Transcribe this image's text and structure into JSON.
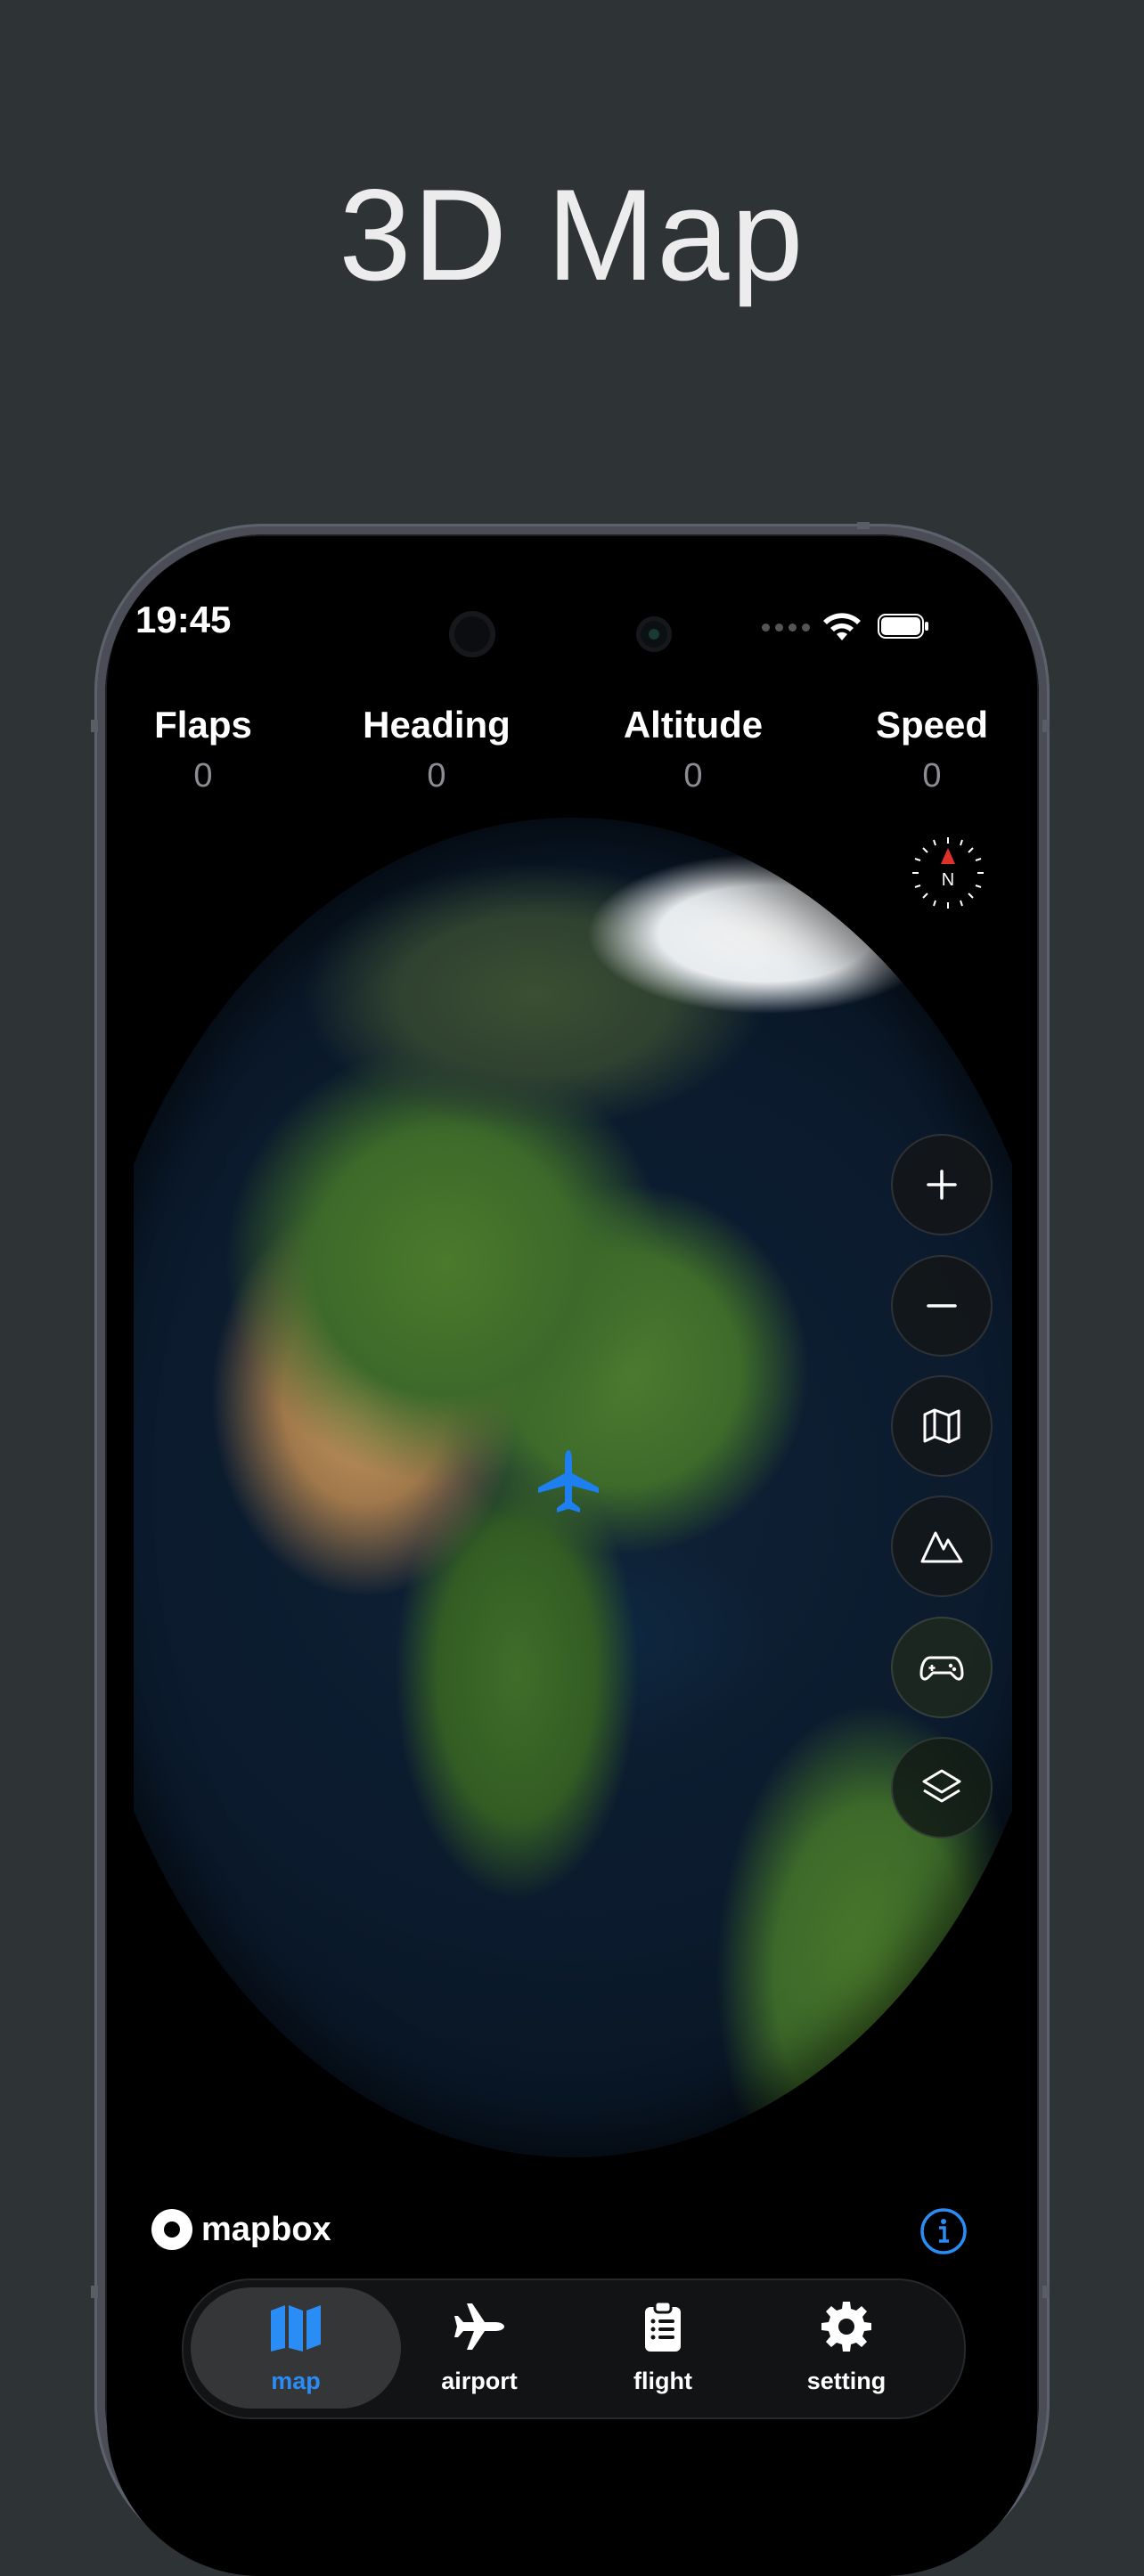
{
  "promo": {
    "title": "3D Map"
  },
  "status_bar": {
    "time": "19:45",
    "wifi_icon": "wifi-icon",
    "battery_icon": "battery-icon"
  },
  "readouts": [
    {
      "label": "Flaps",
      "value": "0"
    },
    {
      "label": "Heading",
      "value": "0"
    },
    {
      "label": "Altitude",
      "value": "0"
    },
    {
      "label": "Speed",
      "value": "0"
    }
  ],
  "compass": {
    "label": "N",
    "icon": "compass-icon"
  },
  "map_controls": [
    {
      "name": "zoom-in",
      "icon": "plus-icon"
    },
    {
      "name": "zoom-out",
      "icon": "minus-icon"
    },
    {
      "name": "map-style",
      "icon": "map-icon"
    },
    {
      "name": "terrain",
      "icon": "mountain-icon"
    },
    {
      "name": "gamepad",
      "icon": "gamepad-icon"
    },
    {
      "name": "layers",
      "icon": "layers-icon"
    }
  ],
  "attribution": {
    "brand": "mapbox",
    "info_icon": "info-icon"
  },
  "tabs": [
    {
      "label": "map",
      "icon": "map-icon",
      "active": true
    },
    {
      "label": "airport",
      "icon": "airplane-icon",
      "active": false
    },
    {
      "label": "flight",
      "icon": "clipboard-icon",
      "active": false
    },
    {
      "label": "setting",
      "icon": "gear-icon",
      "active": false
    }
  ],
  "colors": {
    "accent": "#2a8cf5",
    "background": "#2e3335",
    "compass_needle": "#e0302a"
  }
}
